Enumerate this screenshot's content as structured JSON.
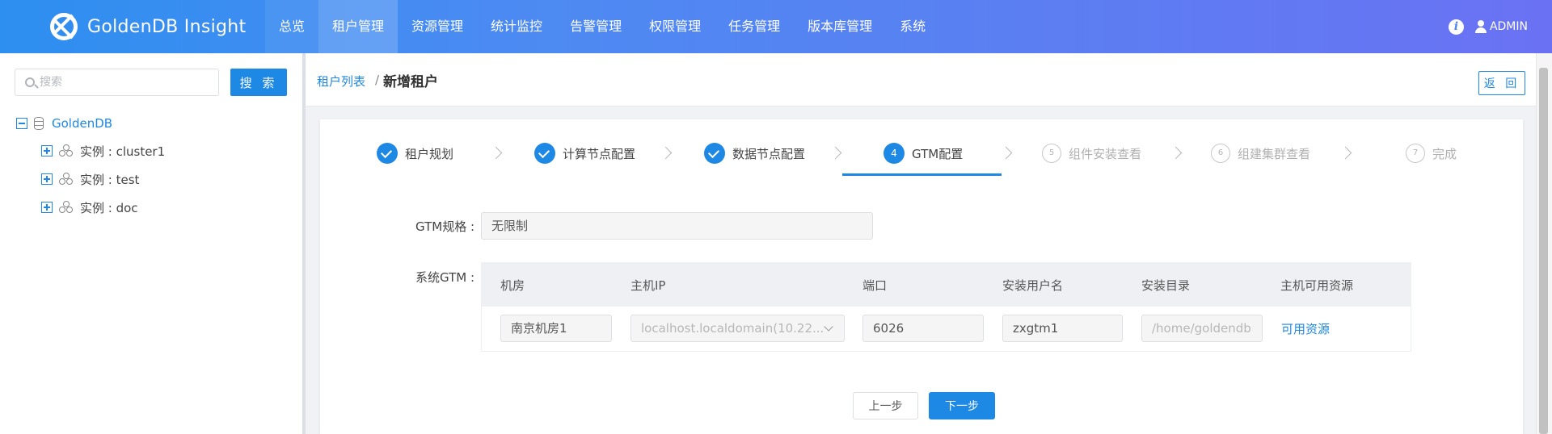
{
  "header": {
    "brand": "GoldenDB Insight",
    "nav": [
      "总览",
      "租户管理",
      "资源管理",
      "统计监控",
      "告警管理",
      "权限管理",
      "任务管理",
      "版本库管理",
      "系统"
    ],
    "active_nav": "租户管理",
    "info_icon": "i",
    "user": "ADMIN"
  },
  "sidebar": {
    "search_placeholder": "搜索",
    "search_button": "搜 索",
    "tree": {
      "root": "GoldenDB",
      "children": [
        "实例 : cluster1",
        "实例 : test",
        "实例 : doc"
      ]
    }
  },
  "breadcrumb": {
    "parent": "租户列表",
    "separator": "/",
    "current": "新增租户",
    "back_button": "返 回"
  },
  "steps": [
    {
      "num": "1",
      "label": "租户规划",
      "status": "done"
    },
    {
      "num": "2",
      "label": "计算节点配置",
      "status": "done"
    },
    {
      "num": "3",
      "label": "数据节点配置",
      "status": "done"
    },
    {
      "num": "4",
      "label": "GTM配置",
      "status": "current"
    },
    {
      "num": "5",
      "label": "组件安装查看",
      "status": "wait"
    },
    {
      "num": "6",
      "label": "组建集群查看",
      "status": "wait"
    },
    {
      "num": "7",
      "label": "完成",
      "status": "wait"
    }
  ],
  "form": {
    "gtm_spec_label": "GTM规格 :",
    "gtm_spec_value": "无限制",
    "system_gtm_label": "系统GTM :",
    "table": {
      "columns": [
        "机房",
        "主机IP",
        "端口",
        "安装用户名",
        "安装目录",
        "主机可用资源"
      ],
      "row": {
        "room": "南京机房1",
        "host_ip": "localhost.localdomain(10.22...",
        "port": "6026",
        "install_user": "zxgtm1",
        "install_dir": "/home/goldendb",
        "resource_link": "可用资源"
      }
    }
  },
  "actions": {
    "prev": "上一步",
    "next": "下一步"
  },
  "colors": {
    "primary": "#1e88e5",
    "header_gradient_start": "#2d8ff0",
    "header_gradient_end": "#6a72f3"
  }
}
